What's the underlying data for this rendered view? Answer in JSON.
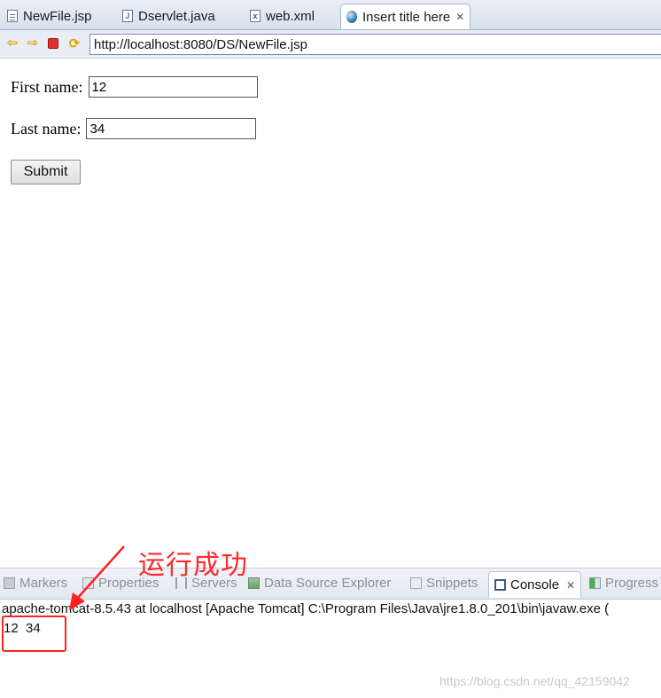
{
  "editor_tabs": [
    {
      "label": "NewFile.jsp",
      "icon": "file-icon"
    },
    {
      "label": "Dservlet.java",
      "icon": "java-file-icon"
    },
    {
      "label": "web.xml",
      "icon": "xml-file-icon"
    },
    {
      "label": "Insert title here",
      "icon": "globe-icon",
      "active": true
    }
  ],
  "browser": {
    "url": "http://localhost:8080/DS/NewFile.jsp"
  },
  "form": {
    "first_name_label": "First name:",
    "first_name_value": "12",
    "last_name_label": "Last name:",
    "last_name_value": "34",
    "submit_label": "Submit"
  },
  "panel_tabs": [
    {
      "label": "Markers"
    },
    {
      "label": "Properties"
    },
    {
      "label": "Servers"
    },
    {
      "label": "Data Source Explorer"
    },
    {
      "label": "Snippets"
    },
    {
      "label": "Console",
      "active": true
    },
    {
      "label": "Progress"
    }
  ],
  "console": {
    "header": "apache-tomcat-8.5.43 at localhost [Apache Tomcat] C:\\Program Files\\Java\\jre1.8.0_201\\bin\\javaw.exe (",
    "output": "12  34"
  },
  "annotation": {
    "text": "运行成功",
    "color": "#ff2020"
  },
  "watermark": "https://blog.csdn.net/qq_42159042"
}
